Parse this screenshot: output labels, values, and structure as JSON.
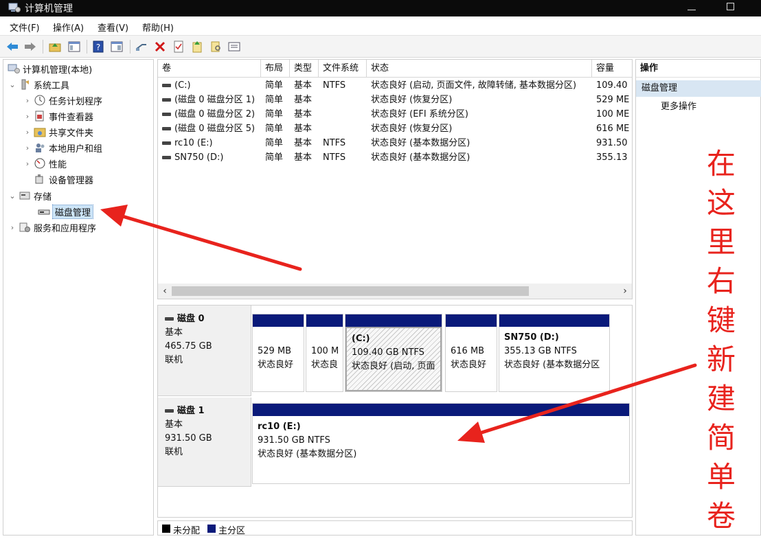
{
  "window": {
    "title": "计算机管理"
  },
  "menu": [
    "文件(F)",
    "操作(A)",
    "查看(V)",
    "帮助(H)"
  ],
  "tree": {
    "root": "计算机管理(本地)",
    "system_tools": "系统工具",
    "task_scheduler": "任务计划程序",
    "event_viewer": "事件查看器",
    "shared_folders": "共享文件夹",
    "local_users": "本地用户和组",
    "performance": "性能",
    "device_manager": "设备管理器",
    "storage": "存储",
    "disk_management": "磁盘管理",
    "services_apps": "服务和应用程序"
  },
  "volume_list": {
    "columns": [
      "卷",
      "布局",
      "类型",
      "文件系统",
      "状态",
      "容量"
    ],
    "rows": [
      [
        "(C:)",
        "简单",
        "基本",
        "NTFS",
        "状态良好 (启动, 页面文件, 故障转储, 基本数据分区)",
        "109.40"
      ],
      [
        "(磁盘 0 磁盘分区 1)",
        "简单",
        "基本",
        "",
        "状态良好 (恢复分区)",
        "529 ME"
      ],
      [
        "(磁盘 0 磁盘分区 2)",
        "简单",
        "基本",
        "",
        "状态良好 (EFI 系统分区)",
        "100 ME"
      ],
      [
        "(磁盘 0 磁盘分区 5)",
        "简单",
        "基本",
        "",
        "状态良好 (恢复分区)",
        "616 ME"
      ],
      [
        "rc10 (E:)",
        "简单",
        "基本",
        "NTFS",
        "状态良好 (基本数据分区)",
        "931.50"
      ],
      [
        "SN750 (D:)",
        "简单",
        "基本",
        "NTFS",
        "状态良好 (基本数据分区)",
        "355.13"
      ]
    ]
  },
  "disks": [
    {
      "name": "磁盘 0",
      "type": "基本",
      "size": "465.75 GB",
      "status": "联机",
      "partitions": [
        {
          "name": "",
          "size": "529 MB",
          "status": "状态良好"
        },
        {
          "name": "",
          "size": "100 M",
          "status": "状态良"
        },
        {
          "name": "(C:)",
          "size": "109.40 GB NTFS",
          "status": "状态良好 (启动, 页面"
        },
        {
          "name": "",
          "size": "616 MB",
          "status": "状态良好"
        },
        {
          "name": "SN750  (D:)",
          "size": "355.13 GB NTFS",
          "status": "状态良好 (基本数据分区"
        }
      ]
    },
    {
      "name": "磁盘 1",
      "type": "基本",
      "size": "931.50 GB",
      "status": "联机",
      "partitions": [
        {
          "name": "rc10  (E:)",
          "size": "931.50 GB NTFS",
          "status": "状态良好 (基本数据分区)"
        }
      ]
    }
  ],
  "legend": {
    "unallocated": "未分配",
    "primary": "主分区",
    "unallocated_color": "#000000",
    "primary_color": "#0a1a7a"
  },
  "actions": {
    "header": "操作",
    "section": "磁盘管理",
    "more": "更多操作"
  },
  "annotation": {
    "chars": [
      "在",
      "这",
      "里",
      "右",
      "键",
      "新",
      "建",
      "简",
      "单",
      "卷"
    ],
    "color": "#e8231d"
  }
}
